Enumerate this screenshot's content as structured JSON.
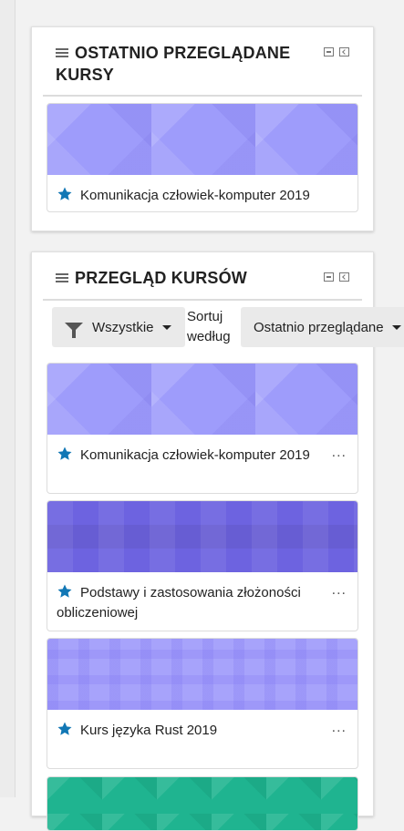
{
  "recent_block": {
    "title": "OSTATNIO PRZEGLĄDANE KURSY",
    "course": "Komunikacja człowiek-komputer 2019"
  },
  "overview_block": {
    "title": "PRZEGLĄD KURSÓW",
    "filter_label": "Wszystkie",
    "sort_label": "Sortuj według",
    "sort_value": "Ostatnio przeglądane",
    "courses": [
      {
        "name": "Komunikacja człowiek-komputer 2019"
      },
      {
        "name": "Podstawy i zastosowania złożoności obliczeniowej"
      },
      {
        "name": "Kurs języka Rust 2019"
      }
    ],
    "menu_label": "..."
  },
  "colors": {
    "star": "#1177b5",
    "pattern_purple": "#9e9cfb",
    "pattern_violet": "#6d63e0",
    "pattern_plaid": "#a7a3fb",
    "pattern_teal": "#1fb490"
  }
}
